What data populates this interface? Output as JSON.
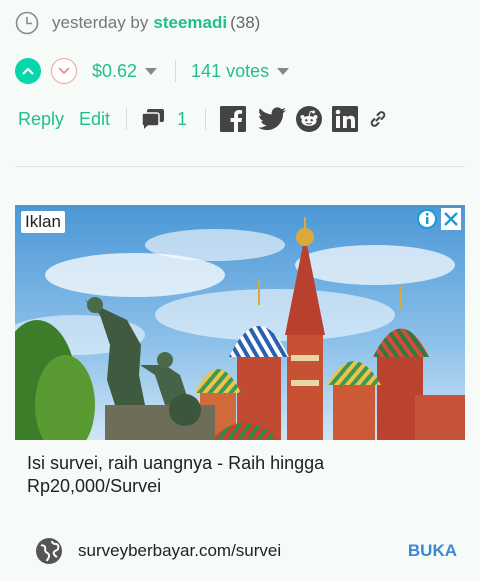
{
  "post_meta": {
    "time": "yesterday by",
    "author": "steemadi",
    "reputation": "(38)"
  },
  "votes": {
    "payout": "$0.62",
    "count": "141 votes"
  },
  "actions": {
    "reply": "Reply",
    "edit": "Edit",
    "comment_count": "1"
  },
  "share_icons": [
    "facebook-icon",
    "twitter-icon",
    "reddit-icon",
    "linkedin-icon",
    "link-icon"
  ],
  "ad": {
    "label": "Iklan",
    "title": "Isi survei, raih uangnya - Raih hingga Rp20,000/Survei",
    "url": "surveyberbayar.com/survei",
    "cta": "BUKA"
  },
  "colors": {
    "accent": "#1fbf8f",
    "upvote": "#06d6a9",
    "downvote_border": "#f0a0a0",
    "cta": "#3b87d8",
    "background": "#f7fbf8"
  }
}
